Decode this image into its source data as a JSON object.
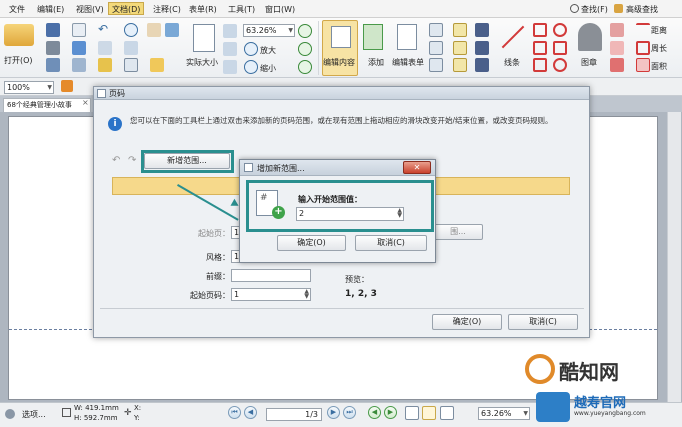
{
  "menu": {
    "items": [
      "文件",
      "编辑(E)",
      "视图(V)",
      "文档(D)",
      "注释(C)",
      "表单(R)",
      "工具(T)",
      "窗口(W)"
    ],
    "find_label": "查找(F)",
    "advanced_find_label": "高级查找"
  },
  "ribbon": {
    "open_label": "打开(O)",
    "zoom_value": "63.26%",
    "actual_size_label": "实际大小",
    "zoom_in_label": "放大",
    "zoom_out_label": "缩小",
    "edit_content_label": "编辑内容",
    "add_label": "添加",
    "edit_form_label": "编辑表单",
    "lines_label": "线条",
    "stamp_label": "图章",
    "distance_label": "距离",
    "perimeter_label": "周长",
    "area_label": "面积"
  },
  "strip": {
    "zoom_value": "100%"
  },
  "doc_tab": {
    "title": "68个经典管理小故事"
  },
  "dialog": {
    "title": "页码",
    "info": "您可以在下面的工具栏上通过双击来添加新的页码范围，或在现有范围上拖动相应的滑块改变开始/结束位置，或改变页码规则。",
    "new_range_button": "新增范围...",
    "start_page_label": "起始页：",
    "start_page_value": "1",
    "style_label": "风格：",
    "style_value": "1",
    "prefix_label": "前缀：",
    "prefix_value": "",
    "start_number_label": "起始页码：",
    "start_number_value": "1",
    "preview_label": "预览：",
    "preview_value": "1, 2, 3",
    "range_button_suffix": "围...",
    "ok_button": "确定(O)",
    "cancel_button": "取消(C)"
  },
  "inner_dialog": {
    "title": "增加新范围...",
    "prompt": "输入开始范围值：",
    "value": "2",
    "ok_button": "确定(O)",
    "cancel_button": "取消(C)"
  },
  "statusbar": {
    "options_label": "选项...",
    "width_label": "W: 419.1mm",
    "height_label": "H: 592.7mm",
    "x_label": "X:",
    "y_label": "Y:",
    "page_value": "1",
    "page_total": "/3",
    "zoom_value": "63.26%"
  },
  "watermarks": {
    "brand1": "酷知网",
    "brand2": "越寿官网",
    "url": "www.yueyangbang.com"
  },
  "colors": {
    "highlight": "#2a8f8f",
    "yellow_bar": "#f6d98b",
    "active_menu": "#f3d97a"
  }
}
